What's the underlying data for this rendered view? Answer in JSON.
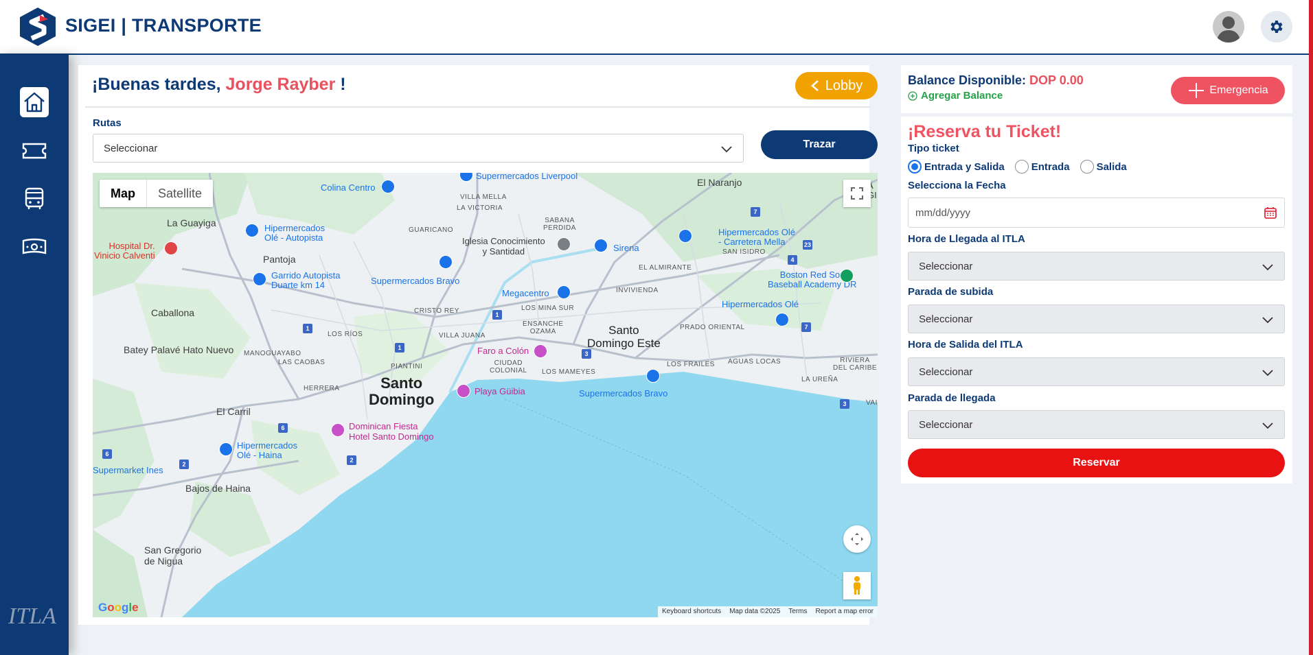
{
  "header": {
    "brand": "SIGEI | TRANSPORTE"
  },
  "sidebar": {
    "items": [
      {
        "name": "home-icon",
        "active": true
      },
      {
        "name": "ticket-icon",
        "active": false
      },
      {
        "name": "bus-icon",
        "active": false
      },
      {
        "name": "money-icon",
        "active": false
      }
    ],
    "footer_logo": "ITLA"
  },
  "greeting": {
    "prefix": "¡Buenas tardes, ",
    "name": "Jorge Rayber",
    "suffix": " !"
  },
  "lobby_label": "Lobby",
  "rutas": {
    "label": "Rutas",
    "selected": "Seleccionar",
    "button": "Trazar"
  },
  "map": {
    "tabs": [
      "Map",
      "Satellite"
    ],
    "active_tab": "Map",
    "labels": {
      "santo_domingo": "Santo\nDomingo",
      "santo_domingo_este": "Santo\nDomingo Este",
      "la_guayiga": "La Guayiga",
      "pantoja": "Pantoja",
      "caballona": "Caballona",
      "batey": "Batey Palavé Hato Nuevo",
      "el_carril": "El Carril",
      "bajos_de_haina": "Bajos de Haina",
      "san_gregorio": "San Gregorio\nde Nigua",
      "el_naranjo": "El Naranjo",
      "colina_centro": "Colina Centro",
      "supermercados_liverpool": "Supermercados Liverpool",
      "hiper_ole_autopista": "Hipermercados\nOlé - Autopista",
      "hospital": "Hospital Dr.\nVinicio Calventi",
      "garrido": "Garrido Autopista\nDuarte km 14",
      "iglesia": "Iglesia Conocimiento\ny Santidad",
      "sirena": "Sirena",
      "hiper_ole_mella": "Hipermercados Olé\n- Carretera Mella",
      "boston": "Boston Red Sox\nBaseball Academy DR",
      "supermercados_bravo_1": "Supermercados Bravo",
      "megacentro": "Megacentro",
      "hiper_ole": "Hipermercados Olé",
      "faro": "Faro a Colón",
      "playa": "Playa Güibia",
      "supermercados_bravo_2": "Supermercados Bravo",
      "dominican_fiesta": "Dominican Fiesta\nHotel Santo Domingo",
      "hiper_ole_haina": "Hipermercados\nOlé - Haina",
      "supermarket_ines": "Supermarket Ines",
      "villa_mella": "VILLA MELLA",
      "la_victoria": "LA VICTORIA",
      "guaricano": "GUARICANO",
      "sabana_perdida": "SABANA\nPERDIDA",
      "san_isidro": "SAN ISIDRO",
      "el_almirante": "EL ALMIRANTE",
      "invivienda": "INVIVIENDA",
      "cristo_rey": "CRISTO REY",
      "los_mina_sur": "LOS MINA SUR",
      "ensanche_ozama": "ENSANCHE\nOZAMA",
      "prado_oriental": "PRADO ORIENTAL",
      "los_rios": "LOS RÍOS",
      "villa_juana": "VILLA JUANA",
      "manoguayabo": "MANOGUAYABO",
      "las_caobas": "LAS CAOBAS",
      "piantini": "PIANTINI",
      "ciudad_colonial": "CIUDAD\nCOLONIAL",
      "los_mameyes": "LOS MAMEYES",
      "los_frailes": "LOS FRAILES",
      "aguas_locas": "AGUAS LOCAS",
      "la_urena": "LA UREÑA",
      "riviera": "RIVIERA\nDEL CARIBE",
      "herrera": "HERRERA",
      "aeropuerto_short": "A\nGI",
      "vai": "VAI"
    },
    "footer": [
      "Keyboard shortcuts",
      "Map data ©2025",
      "Terms",
      "Report a map error"
    ],
    "google": "Google"
  },
  "balance": {
    "label": "Balance Disponible: ",
    "value": "DOP 0.00",
    "add_label": "Agregar Balance",
    "emergency_label": "Emergencia"
  },
  "ticket": {
    "title": "¡Reserva tu Ticket!",
    "type_label": "Tipo ticket",
    "types": [
      "Entrada y Salida",
      "Entrada",
      "Salida"
    ],
    "selected_type": "Entrada y Salida",
    "date_label": "Selecciona la Fecha",
    "date_placeholder": "mm/dd/yyyy",
    "arrival_time_label": "Hora de Llegada al ITLA",
    "arrival_time_value": "Seleccionar",
    "pickup_label": "Parada de subida",
    "pickup_value": "Seleccionar",
    "departure_time_label": "Hora de Salida del ITLA",
    "departure_time_value": "Seleccionar",
    "dropoff_label": "Parada de llegada",
    "dropoff_value": "Seleccionar",
    "submit": "Reservar"
  },
  "colors": {
    "primary": "#0d3a75",
    "accent": "#ef5362",
    "lobby": "#f0a200",
    "reserve": "#e81212",
    "success": "#26a24a"
  }
}
